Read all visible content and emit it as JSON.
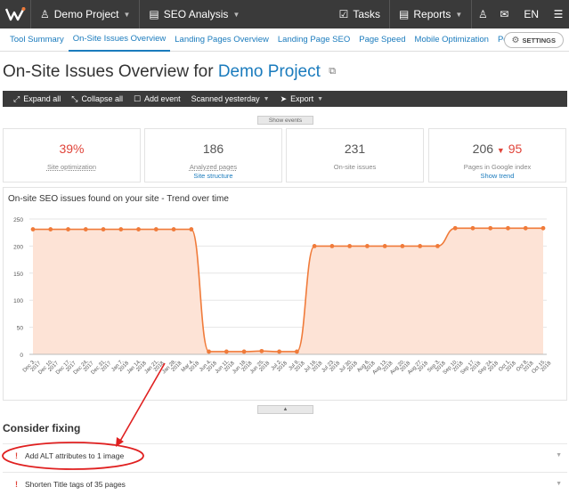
{
  "topbar": {
    "project": "Demo Project",
    "module": "SEO Analysis",
    "tasks": "Tasks",
    "reports": "Reports",
    "lang": "EN"
  },
  "tabs": [
    {
      "label": "Tool Summary",
      "active": false
    },
    {
      "label": "On-Site Issues Overview",
      "active": true
    },
    {
      "label": "Landing Pages Overview",
      "active": false
    },
    {
      "label": "Landing Page SEO",
      "active": false
    },
    {
      "label": "Page Speed",
      "active": false
    },
    {
      "label": "Mobile Optimization",
      "active": false
    },
    {
      "label": "Popular Pages",
      "active": false
    }
  ],
  "settings_label": "SETTINGS",
  "title": {
    "prefix": "On-Site Issues Overview for",
    "project": "Demo Project"
  },
  "toolbar": {
    "expand": "Expand all",
    "collapse": "Collapse all",
    "add_event": "Add event",
    "scanned": "Scanned yesterday",
    "export": "Export"
  },
  "show_events": "Show events",
  "cards": [
    {
      "value": "39%",
      "label": "Site optimization"
    },
    {
      "value": "186",
      "label": "Analyzed pages",
      "sub": "Site structure"
    },
    {
      "value": "231",
      "label": "On-site issues"
    },
    {
      "value": "206",
      "value2": "95",
      "label": "Pages in Google index",
      "sub": "Show trend"
    }
  ],
  "chart_data": {
    "type": "area",
    "title": "On-site SEO issues found on your site - Trend over time",
    "ylim": [
      0,
      250
    ],
    "yticks": [
      0,
      50,
      100,
      150,
      200,
      250
    ],
    "categories": [
      "Dec 3, 2017",
      "Dec 10, 2017",
      "Dec 17, 2017",
      "Dec 24, 2017",
      "Dec 31, 2017",
      "Jan 7, 2018",
      "Jan 14, 2018",
      "Jan 21, 2018",
      "Jan 28, 2018",
      "Mar 4, 2018",
      "Jun 4, 2018",
      "Jun 11, 2018",
      "Jun 18, 2018",
      "Jun 25, 2018",
      "Jul 2, 2018",
      "Jul 9, 2018",
      "Jul 16, 2018",
      "Jul 23, 2018",
      "Jul 30, 2018",
      "Aug 6, 2018",
      "Aug 13, 2018",
      "Aug 20, 2018",
      "Aug 27, 2018",
      "Sep 3, 2018",
      "Sep 10, 2018",
      "Sep 17, 2018",
      "Sep 24, 2018",
      "Oct 1, 2018",
      "Oct 8, 2018",
      "Oct 15, 2018"
    ],
    "values": [
      231,
      231,
      231,
      231,
      231,
      231,
      231,
      231,
      231,
      231,
      5,
      5,
      5,
      6,
      5,
      5,
      200,
      200,
      200,
      200,
      200,
      200,
      200,
      200,
      233,
      233,
      233,
      233,
      233,
      233
    ],
    "color": "#f07b3a",
    "fill": "#fde3d6",
    "grid": true
  },
  "section_title": "Consider fixing",
  "issues": [
    {
      "text": "Add ALT attributes to 1 image"
    },
    {
      "text": "Shorten Title tags of 35 pages"
    }
  ]
}
